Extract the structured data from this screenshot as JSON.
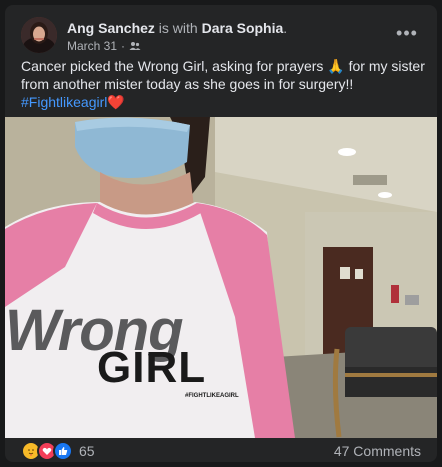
{
  "post": {
    "author": "Ang Sanchez",
    "with_text": "is with",
    "tagged": "Dara Sophia",
    "date": "March 31",
    "separator": "·",
    "audience_icon": "friends-icon",
    "more_icon": "more-horizontal-icon",
    "more_label": "•••",
    "text_line": "Cancer picked the Wrong Girl, asking for prayers 🙏 for my sister from another mister today as she goes in for surgery!!",
    "hashtag": "#Fightlikeagirl",
    "hashtag_emoji": "❤️"
  },
  "photo": {
    "shirt_text_1": "Wrong",
    "shirt_text_2": "GIRL",
    "shirt_text_3": "#FIGHTLIKEAGIRL"
  },
  "footer": {
    "reaction_icons": [
      "care-reaction-icon",
      "love-reaction-icon",
      "like-reaction-icon"
    ],
    "reaction_count": "65",
    "comments": "47 Comments"
  },
  "colors": {
    "background": "#18191a",
    "card": "#242526",
    "text": "#e4e6eb",
    "secondary": "#b0b3b8",
    "link": "#4599ff"
  }
}
